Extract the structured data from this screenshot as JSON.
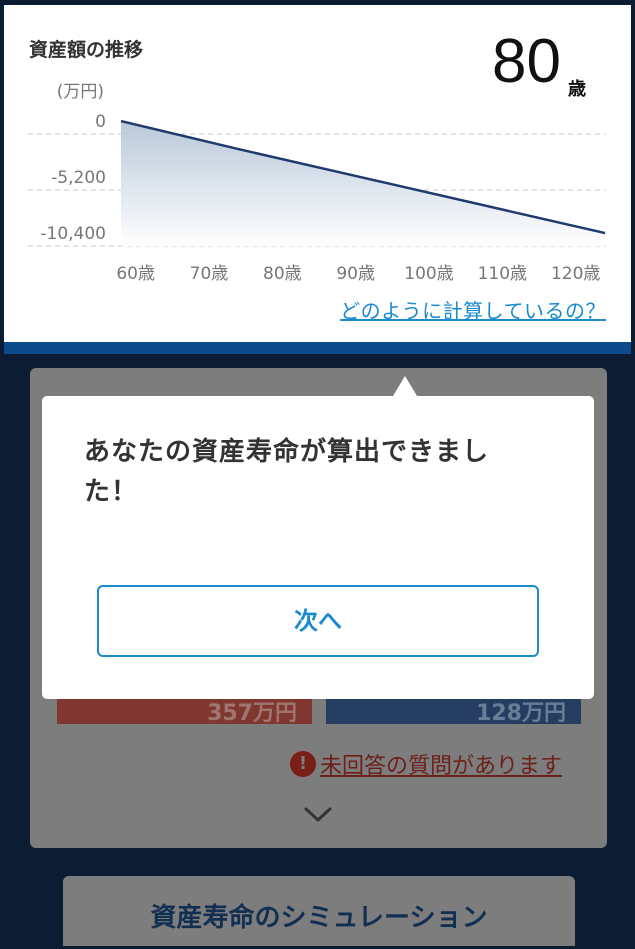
{
  "chart_panel": {
    "title": "資産額の推移",
    "age_value": "80",
    "age_unit": "歳",
    "unit_label": "(万円)",
    "help_link": "どのように計算しているの？"
  },
  "chart_data": {
    "type": "area",
    "title": "資産額の推移",
    "ylabel": "(万円)",
    "xlabel": "",
    "x": [
      58,
      124
    ],
    "y": [
      1200,
      -9200
    ],
    "y_ticks": [
      0,
      -5200,
      -10400
    ],
    "y_tick_labels": [
      "0",
      "-5,200",
      "-10,400"
    ],
    "x_ticks": [
      60,
      70,
      80,
      90,
      100,
      110,
      120
    ],
    "x_tick_labels": [
      "60歳",
      "70歳",
      "80歳",
      "90歳",
      "100歳",
      "110歳",
      "120歳"
    ],
    "xlim": [
      58,
      124
    ],
    "ylim": [
      -10400,
      1600
    ],
    "grid": true,
    "line_color": "#1e3a6e"
  },
  "background_card": {
    "bar_red_value": "357万円",
    "bar_blue_value": "128万円",
    "warning_text": "未回答の質問があります",
    "warning_icon": "!",
    "simulation_button": "資産寿命のシミュレーション"
  },
  "popup": {
    "message": "あなたの資産寿命が算出できました！",
    "next_button": "次へ"
  }
}
